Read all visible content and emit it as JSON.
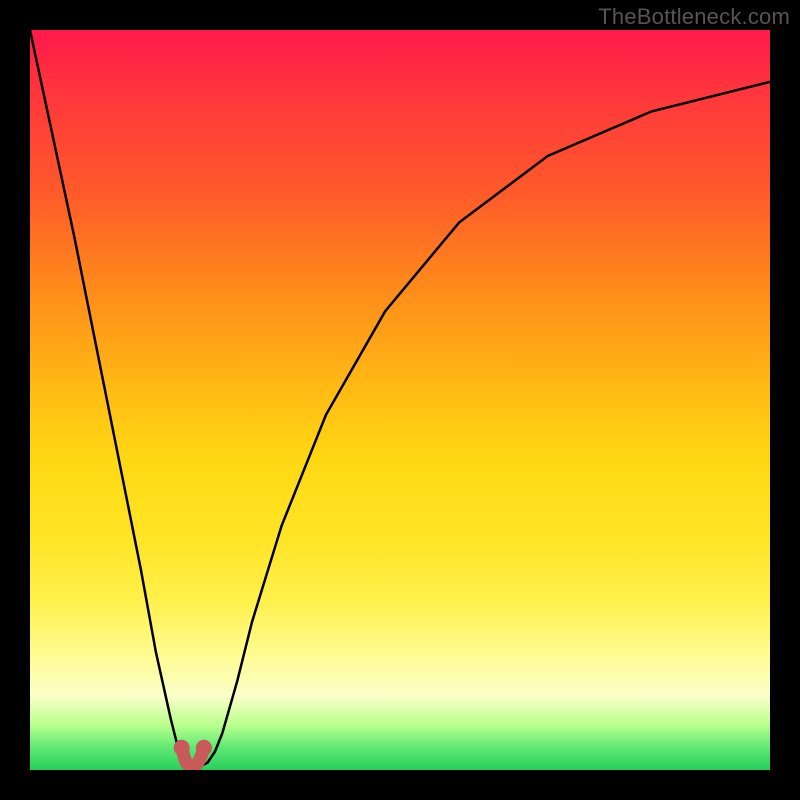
{
  "watermark": {
    "text": "TheBottleneck.com"
  },
  "colors": {
    "frame": "#000000",
    "curve": "#000000",
    "marker": "#c85a5a",
    "gradient_top": "#ff1a4b",
    "gradient_bottom": "#28cf5b"
  },
  "chart_data": {
    "type": "line",
    "title": "",
    "xlabel": "",
    "ylabel": "",
    "xlim": [
      0,
      100
    ],
    "ylim": [
      0,
      100
    ],
    "grid": false,
    "series": [
      {
        "name": "bottleneck-curve",
        "x": [
          0,
          3,
          6,
          9,
          12,
          15,
          17,
          19,
          20,
          21,
          22,
          23,
          24,
          25,
          26,
          28,
          30,
          34,
          40,
          48,
          58,
          70,
          84,
          100
        ],
        "y": [
          100,
          86,
          72,
          57,
          42,
          27,
          16,
          7,
          3,
          1,
          0.5,
          0.5,
          1,
          2.5,
          5,
          12,
          20,
          33,
          48,
          62,
          74,
          83,
          89,
          93
        ]
      }
    ],
    "markers": {
      "name": "optimal-point",
      "shape": "u",
      "x": [
        20.5,
        21,
        21.5,
        22,
        22.5,
        23,
        23.5
      ],
      "y": [
        3,
        1.2,
        0.6,
        0.5,
        0.7,
        1.5,
        3
      ]
    }
  }
}
